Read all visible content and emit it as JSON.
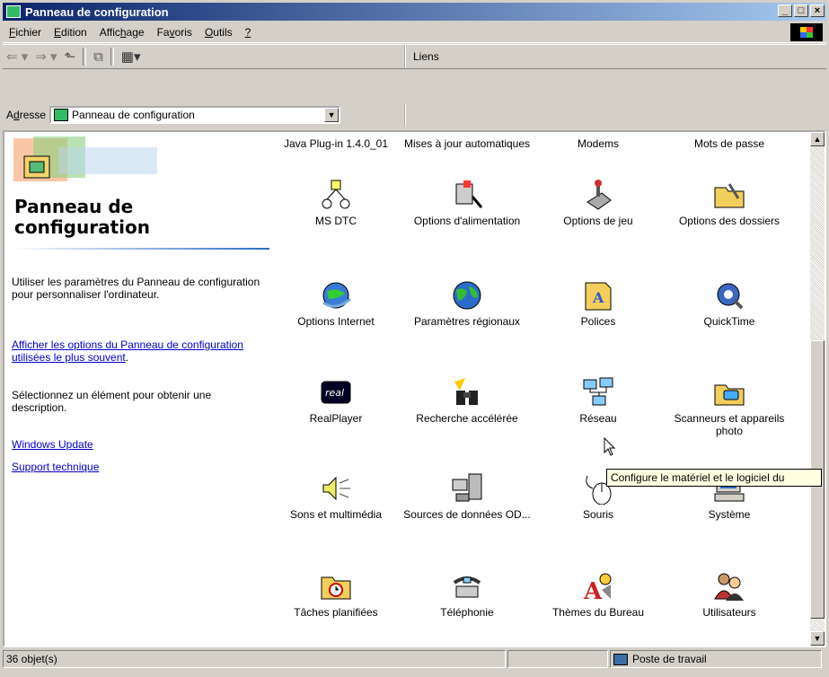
{
  "window": {
    "title": "Panneau de configuration"
  },
  "menu": [
    "Fichier",
    "Edition",
    "Affichage",
    "Favoris",
    "Outils",
    "?"
  ],
  "menu_underline": [
    "F",
    "E",
    "h",
    "v",
    "O",
    "?"
  ],
  "toolbar": {
    "links_label": "Liens"
  },
  "address": {
    "label": "Adresse",
    "value": "Panneau de configuration"
  },
  "left_pane": {
    "title": "Panneau de configuration",
    "title_line1": "Panneau de",
    "title_line2": "configuration",
    "description": "Utiliser les paramètres du Panneau de configuration pour personnaliser l'ordinateur.",
    "link_frequent": "Afficher les options du Panneau de configuration utilisées le plus souvent",
    "hint": "Sélectionnez un élément pour obtenir une description.",
    "link_update": "Windows Update",
    "link_support": "Support technique"
  },
  "items_top": [
    {
      "label": "Java Plug-in 1.4.0_01"
    },
    {
      "label": "Mises à jour automatiques"
    },
    {
      "label": "Modems"
    },
    {
      "label": "Mots de passe"
    }
  ],
  "items": [
    {
      "label": "MS DTC",
      "icon": "ms-dtc-icon"
    },
    {
      "label": "Options d'alimentation",
      "icon": "power-plug-icon"
    },
    {
      "label": "Options de jeu",
      "icon": "joystick-icon"
    },
    {
      "label": "Options des dossiers",
      "icon": "folder-options-icon"
    },
    {
      "label": "Options Internet",
      "icon": "internet-globe-icon"
    },
    {
      "label": "Paramètres régionaux",
      "icon": "globe-icon"
    },
    {
      "label": "Polices",
      "icon": "fonts-folder-icon"
    },
    {
      "label": "QuickTime",
      "icon": "quicktime-icon"
    },
    {
      "label": "RealPlayer",
      "icon": "realplayer-icon"
    },
    {
      "label": "Recherche accélérée",
      "icon": "binoculars-icon"
    },
    {
      "label": "Réseau",
      "icon": "network-computers-icon"
    },
    {
      "label": "Scanneurs et appareils photo",
      "icon": "scanner-camera-icon"
    },
    {
      "label": "Sons et multimédia",
      "icon": "speaker-icon"
    },
    {
      "label": "Sources de données OD...",
      "icon": "odbc-icon"
    },
    {
      "label": "Souris",
      "icon": "mouse-icon"
    },
    {
      "label": "Système",
      "icon": "computer-icon"
    },
    {
      "label": "Tâches planifiées",
      "icon": "scheduled-tasks-icon"
    },
    {
      "label": "Téléphonie",
      "icon": "telephony-icon"
    },
    {
      "label": "Thèmes du Bureau",
      "icon": "desktop-themes-icon"
    },
    {
      "label": "Utilisateurs",
      "icon": "users-icon"
    }
  ],
  "tooltip": "Configure le matériel et le logiciel du",
  "status": {
    "count": "36 objet(s)",
    "zone": "Poste de travail"
  }
}
